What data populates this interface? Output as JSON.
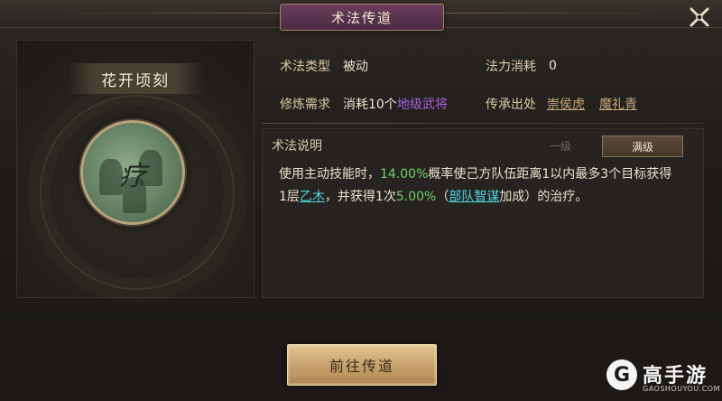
{
  "header": {
    "title": "术法传道"
  },
  "skill": {
    "name": "花开顷刻",
    "icon_glyph": "疗"
  },
  "info": {
    "type_label": "术法类型",
    "type_value": "被动",
    "cost_label": "法力消耗",
    "cost_value": "0",
    "req_label": "修炼需求",
    "req_prefix": "消耗10个",
    "req_item": "地级武将",
    "source_label": "传承出处",
    "source_links": [
      "崇侯虎",
      "魔礼青"
    ]
  },
  "description": {
    "header": "术法说明",
    "tab_level1": "一级",
    "tab_max": "满级",
    "line1_prefix": "使用主动技能时，",
    "line1_rate": "14.00%",
    "line1_suffix": "概率使己方队伍距离1以内最多3个目标获得",
    "line2_prefix": "1层",
    "line2_link": "乙木",
    "line2_mid": "，并获得1次",
    "line2_rate": "5.00%",
    "line2_paren_open": "（",
    "line2_link2": "部队智谋",
    "line2_suffix": "加成）的治疗。"
  },
  "button": {
    "label": "前往传道"
  },
  "watermark": {
    "logo": "G",
    "text": "高手游",
    "sub": "GAOSHOUYOU.COM"
  },
  "colors": {
    "accent_gold": "#c6a06a",
    "highlight_green": "#6fd36a",
    "highlight_cyan": "#4fd7e8",
    "highlight_purple": "#a55ee0"
  }
}
